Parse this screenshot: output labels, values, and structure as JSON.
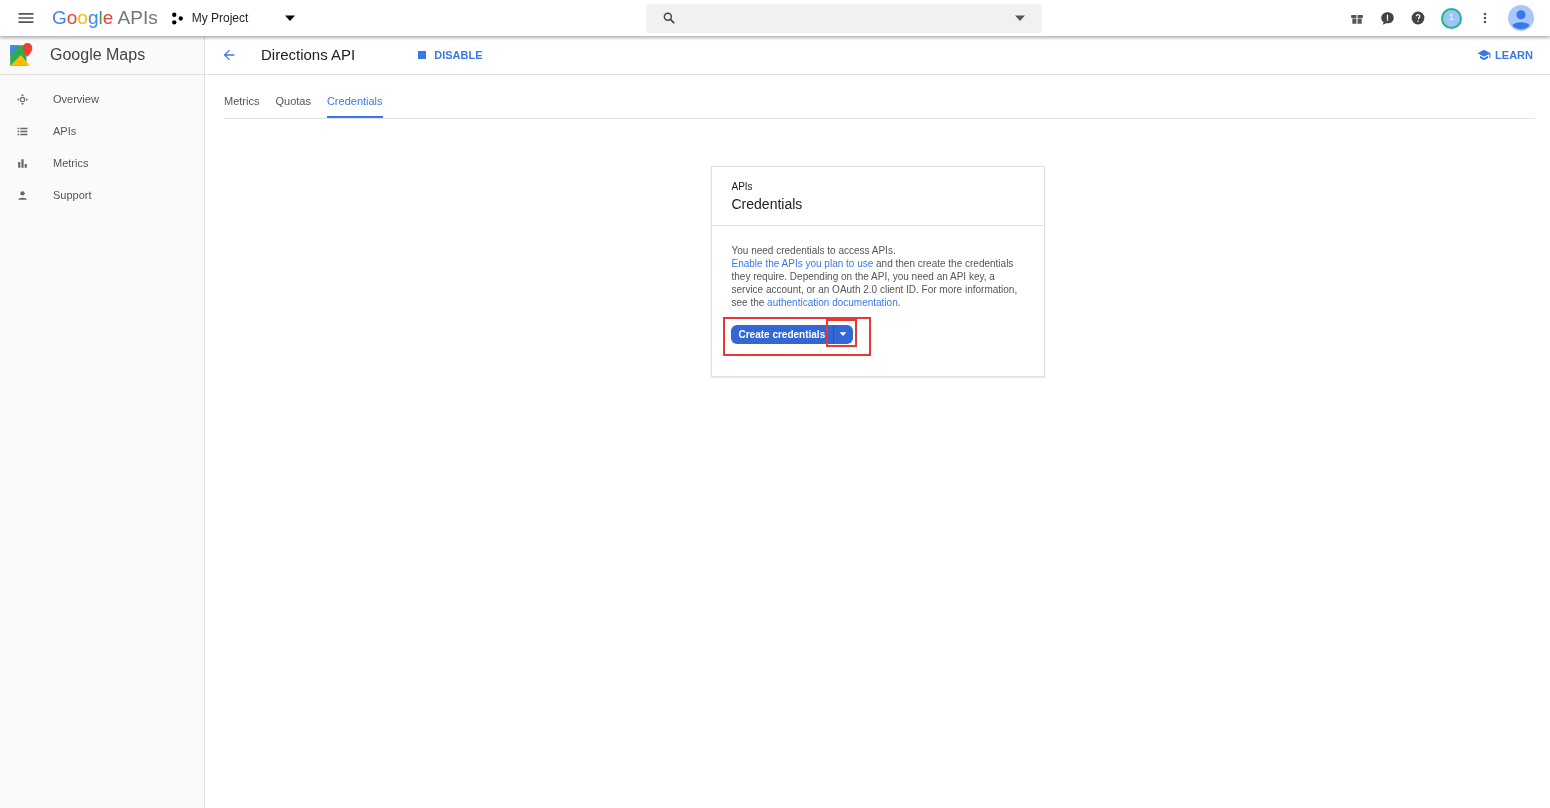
{
  "topbar": {
    "brand": {
      "name": "Google",
      "suffix": "APIs"
    },
    "project": "My Project",
    "notification_count": "1"
  },
  "sidebar": {
    "title": "Google Maps",
    "items": [
      {
        "label": "Overview",
        "selected": false
      },
      {
        "label": "APIs",
        "selected": false
      },
      {
        "label": "Metrics",
        "selected": false
      },
      {
        "label": "Support",
        "selected": false
      }
    ]
  },
  "header": {
    "title": "Directions API",
    "disable": "DISABLE",
    "learn": "LEARN"
  },
  "tabs": [
    {
      "label": "Metrics",
      "selected": false
    },
    {
      "label": "Quotas",
      "selected": false
    },
    {
      "label": "Credentials",
      "selected": true
    }
  ],
  "card": {
    "overline": "APIs",
    "title": "Credentials",
    "description": [
      {
        "text": "You need credentials to access APIs. ",
        "link": false
      },
      {
        "text": "Enable the APIs you plan to use",
        "link": true
      },
      {
        "text": " and then create the credentials they require. Depending on the API, you need an API key, a service account, or an OAuth 2.0 client ID. For more information, see the ",
        "link": false
      },
      {
        "text": "authentication documentation",
        "link": true
      },
      {
        "text": ".",
        "link": false
      }
    ],
    "button": "Create credentials"
  }
}
